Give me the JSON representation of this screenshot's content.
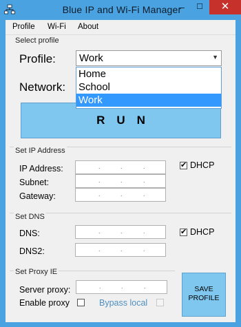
{
  "window": {
    "title": "Blue IP and Wi-Fi  Manager",
    "controls": {
      "minimize": "–",
      "maximize": "☐",
      "close": "✕"
    }
  },
  "menu": [
    "Profile",
    "Wi-Fi",
    "About"
  ],
  "select_profile": {
    "group_label": "Select profile",
    "profile_label": "Profile:",
    "selected": "Work",
    "options": [
      "Home",
      "School",
      "Work"
    ],
    "network_label": "Network:",
    "run_label": "RUN"
  },
  "ip_section": {
    "group_label": "Set IP Address",
    "fields": [
      "IP Address:",
      "Subnet:",
      "Gateway:"
    ],
    "dhcp_label": "DHCP",
    "dhcp_checked": true
  },
  "dns_section": {
    "group_label": "Set DNS",
    "fields": [
      "DNS:",
      "DNS2:"
    ],
    "dhcp_label": "DHCP",
    "dhcp_checked": true
  },
  "proxy_section": {
    "group_label": "Set Proxy IE",
    "server_label": "Server proxy:",
    "enable_label": "Enable proxy",
    "bypass_label": "Bypass local",
    "save_line1": "SAVE",
    "save_line2": "PROFILE"
  },
  "ip_dot": "."
}
